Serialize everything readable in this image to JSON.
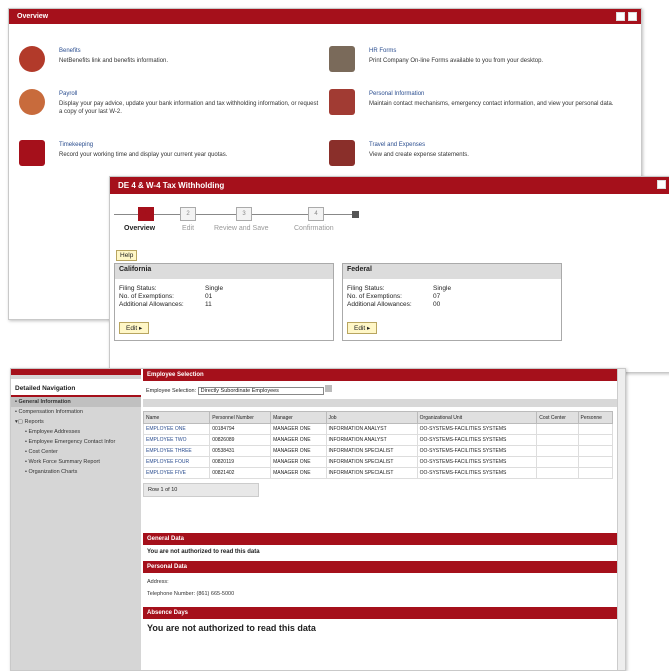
{
  "overview": {
    "title": "Overview",
    "items": [
      {
        "title": "Benefits",
        "desc": "NetBenefits link and benefits information.",
        "icon": "caduceus-icon",
        "color": "#b23a2a"
      },
      {
        "title": "HR Forms",
        "desc": "Print Company On-line Forms available to you from your desktop.",
        "icon": "printer-icon",
        "color": "#7a6a5a"
      },
      {
        "title": "Payroll",
        "desc": "Display your pay advice, update your bank information and tax withholding information, or request a copy of your last W-2.",
        "icon": "coins-icon",
        "color": "#c86b3c"
      },
      {
        "title": "Personal Information",
        "desc": "Maintain contact mechanisms, emergency contact information, and view your personal data.",
        "icon": "id-card-icon",
        "color": "#a13b33"
      },
      {
        "title": "Timekeeping",
        "desc": "Record your working time and display your current year quotas.",
        "icon": "clock-icon",
        "color": "#a5101b"
      },
      {
        "title": "Travel and Expenses",
        "desc": "View and create expense statements.",
        "icon": "suitcase-icon",
        "color": "#8a2f2a"
      }
    ]
  },
  "tax": {
    "title": "DE 4 & W-4 Tax Withholding",
    "steps": [
      {
        "num": "1",
        "label": "Overview"
      },
      {
        "num": "2",
        "label": "Edit"
      },
      {
        "num": "3",
        "label": "Review and Save"
      },
      {
        "num": "4",
        "label": "Confirmation"
      }
    ],
    "help": "Help",
    "california": {
      "title": "California",
      "filing_k": "Filing Status:",
      "filing_v": "Single",
      "ex_k": "No. of Exemptions:",
      "ex_v": "01",
      "add_k": "Additional Allowances:",
      "add_v": "11",
      "edit": "Edit"
    },
    "federal": {
      "title": "Federal",
      "filing_k": "Filing Status:",
      "filing_v": "Single",
      "ex_k": "No. of Exemptions:",
      "ex_v": "07",
      "add_k": "Additional Allowances:",
      "add_v": "00",
      "edit": "Edit"
    }
  },
  "nav": {
    "header": "Detailed Navigation",
    "items": [
      "General Information",
      "Compensation Information",
      "Reports",
      "Employee Addresses",
      "Employee Emergency Contact Infor",
      "Cost Center",
      "Work Force Summary Report",
      "Organization Charts"
    ]
  },
  "emp": {
    "title": "Employee Selection",
    "sel_label": "Employee Selection:",
    "sel_value": "Directly Subordinate Employees",
    "columns": [
      "Name",
      "Personnel Number",
      "Manager",
      "Job",
      "Organizational Unit",
      "Cost Center",
      "Personne"
    ],
    "rows": [
      [
        "EMPLOYEE ONE",
        "00184794",
        "MANAGER ONE",
        "INFORMATION ANALYST",
        "OO-SYSTEMS-FACILITIES SYSTEMS",
        "",
        ""
      ],
      [
        "EMPLOYEE TWO",
        "00826089",
        "MANAGER ONE",
        "INFORMATION ANALYST",
        "OO-SYSTEMS-FACILITIES SYSTEMS",
        "",
        ""
      ],
      [
        "EMPLOYEE THREE",
        "00538431",
        "MANAGER ONE",
        "INFORMATION SPECIALIST",
        "OO-SYSTEMS-FACILITIES SYSTEMS",
        "",
        ""
      ],
      [
        "EMPLOYEE FOUR",
        "00820119",
        "MANAGER ONE",
        "INFORMATION SPECIALIST",
        "OO-SYSTEMS-FACILITIES SYSTEMS",
        "",
        ""
      ],
      [
        "EMPLOYEE FIVE",
        "00821402",
        "MANAGER ONE",
        "INFORMATION SPECIALIST",
        "OO-SYSTEMS-FACILITIES SYSTEMS",
        "",
        ""
      ]
    ],
    "pager": "Row 1 of 10",
    "general": "General Data",
    "not_auth": "You are not authorized to read this data",
    "personal": "Personal Data",
    "address": "Address:",
    "phone": "Telephone Number: (861) 665-5000",
    "absence": "Absence Days",
    "not_auth_big": "You are not authorized to read this data"
  }
}
